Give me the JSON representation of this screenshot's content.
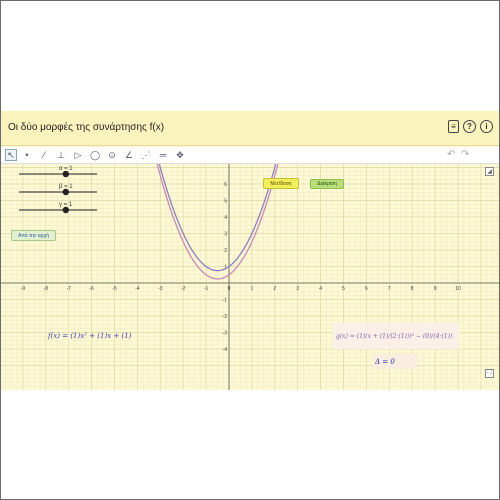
{
  "header": {
    "title": "Οι δύο μορφές της συνάρτησης f(x)"
  },
  "title_icons": [
    "doc-icon",
    "help-icon",
    "info-icon"
  ],
  "toolbar": {
    "tools": [
      "move-icon",
      "point-icon",
      "line-icon",
      "perpendicular-icon",
      "polygon-icon",
      "circle-icon",
      "ellipse-icon",
      "angle-icon",
      "reflect-icon",
      "slider-icon",
      "move-view-icon"
    ],
    "undo": "↶",
    "redo": "↷"
  },
  "sliders": [
    {
      "label": "α = 1",
      "value": 1
    },
    {
      "label": "β = 1",
      "value": 1
    },
    {
      "label": "γ = 1",
      "value": 1
    }
  ],
  "buttons": {
    "start": "Από την αρχή",
    "max": "Μετ/δοση",
    "disc": "Διάκριση"
  },
  "formulas": {
    "f": "f(x) = (1)x² + (1)x + (1)",
    "g": "g(x) = (1)(x + (1)/(2·(1)))² − (0)/(4·(1))",
    "delta": "Δ = 0"
  },
  "chart_data": {
    "type": "line",
    "xlim": [
      -10,
      10
    ],
    "ylim": [
      -4,
      7
    ],
    "x_ticks": [
      -9,
      -8,
      -7,
      -6,
      -5,
      -4,
      -3,
      -2,
      -1,
      0,
      1,
      2,
      3,
      4,
      5,
      6,
      7,
      8,
      9,
      10
    ],
    "y_ticks": [
      -4,
      -3,
      -2,
      -1,
      1,
      2,
      3,
      4,
      5,
      6
    ],
    "grid": true,
    "series": [
      {
        "color": "#8a7ec8",
        "a": 1,
        "b": 1,
        "c": 1
      },
      {
        "color": "#c988b8",
        "a": 1,
        "b": 1,
        "c": 0.5
      }
    ]
  }
}
